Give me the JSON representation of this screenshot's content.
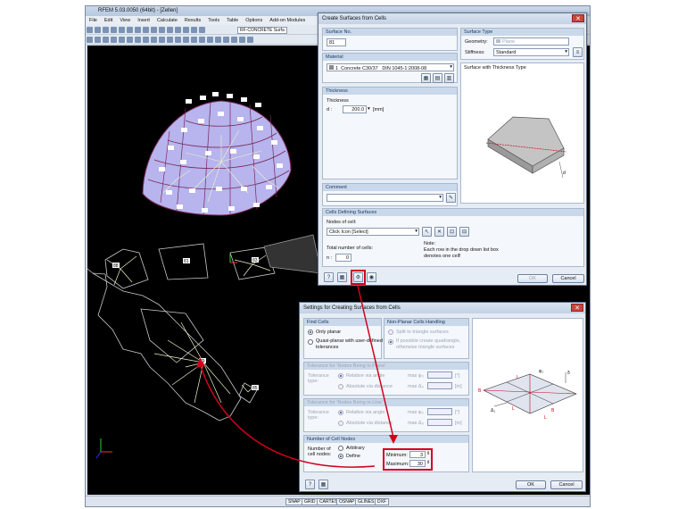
{
  "app": {
    "title": "RFEM 5.03.0050 (64bit) - [Zellen]",
    "menu": [
      "File",
      "Edit",
      "View",
      "Insert",
      "Calculate",
      "Results",
      "Tools",
      "Table",
      "Options",
      "Add-on Modules"
    ],
    "toolbar_module": "RF-CONCRETE Surfa",
    "status_items": [
      "SNAP",
      "GRID",
      "CARTES",
      "OSNAP",
      "GLINES",
      "DXF"
    ]
  },
  "canvas": {
    "labels": [
      "79",
      "83",
      "81",
      "85",
      "88"
    ]
  },
  "dialog1": {
    "title": "Create Surfaces from Cells",
    "surface_no_header": "Surface No.",
    "surface_no": "81",
    "surface_type_header": "Surface Type",
    "geometry_label": "Geometry:",
    "geometry_value": "Plane",
    "stiffness_label": "Stiffness:",
    "stiffness_value": "Standard",
    "material_header": "Material",
    "material_no": "1",
    "material_name": "Concrete C30/37",
    "material_norm": "DIN 1045-1:2008-08",
    "preview_title": "Surface with Thickness Type",
    "thickness_header": "Thickness",
    "thickness_label": "Thickness",
    "d_label": "d :",
    "d_value": "200.0",
    "d_unit": "[mm]",
    "comment_header": "Comment",
    "cells_header": "Cells Defining Surfaces",
    "nodes_label": "Nodes of cell:",
    "nodes_value": "Click Icon [Select]",
    "total_label": "Total number of cells:",
    "n_label": "n :",
    "n_value": "0",
    "note_title": "Note:",
    "note_text_1": "Each row in the drop down list box",
    "note_text_2": "denotes one cell!",
    "ok": "OK",
    "cancel": "Cancel"
  },
  "dialog2": {
    "title": "Settings for Creating Surfaces from Cells",
    "find_header": "Find Cells",
    "only_planar": "Only planar",
    "quasi_planar_1": "Quasi-planar with user-defined",
    "quasi_planar_2": "tolerances",
    "nonplanar_header": "Non-Planar Cells Handling",
    "split": "Split to triangle surfaces",
    "quad_1": "If possible create quadrangle,",
    "quad_2": "otherwise triangle surfaces",
    "tol_plane_header": "Tolerance for 'Nodes Being in Plane'",
    "tol_line_header": "Tolerance for 'Nodes Being in Line'",
    "tol_type_1": "Tolerance",
    "tol_type_2": "type:",
    "rel_angle": "Relative via angle",
    "abs_dist": "Absolute via distance",
    "max_phi": "max φ₀",
    "max_delta": "max Δ₀",
    "unit_deg": "[°]",
    "unit_m": "[m]",
    "cellnodes_header": "Number of Cell Nodes",
    "cellnodes_label_1": "Number of",
    "cellnodes_label_2": "cell nodes:",
    "arbitrary": "Arbitrary",
    "define": "Define",
    "minimum_label": "Minimum:",
    "minimum_value": "3",
    "maximum_label": "Maximum:",
    "maximum_value": "30",
    "diagram_labels": [
      "φ₂",
      "δ",
      "Δ₁",
      "L",
      "B",
      "L",
      "B",
      "L"
    ],
    "ok": "OK",
    "cancel": "Cancel"
  },
  "colors": {
    "highlight": "#d0021b",
    "canvas_bg": "#000000",
    "dome_fill": "#b7b4ee",
    "dome_edge": "#7a2855"
  }
}
